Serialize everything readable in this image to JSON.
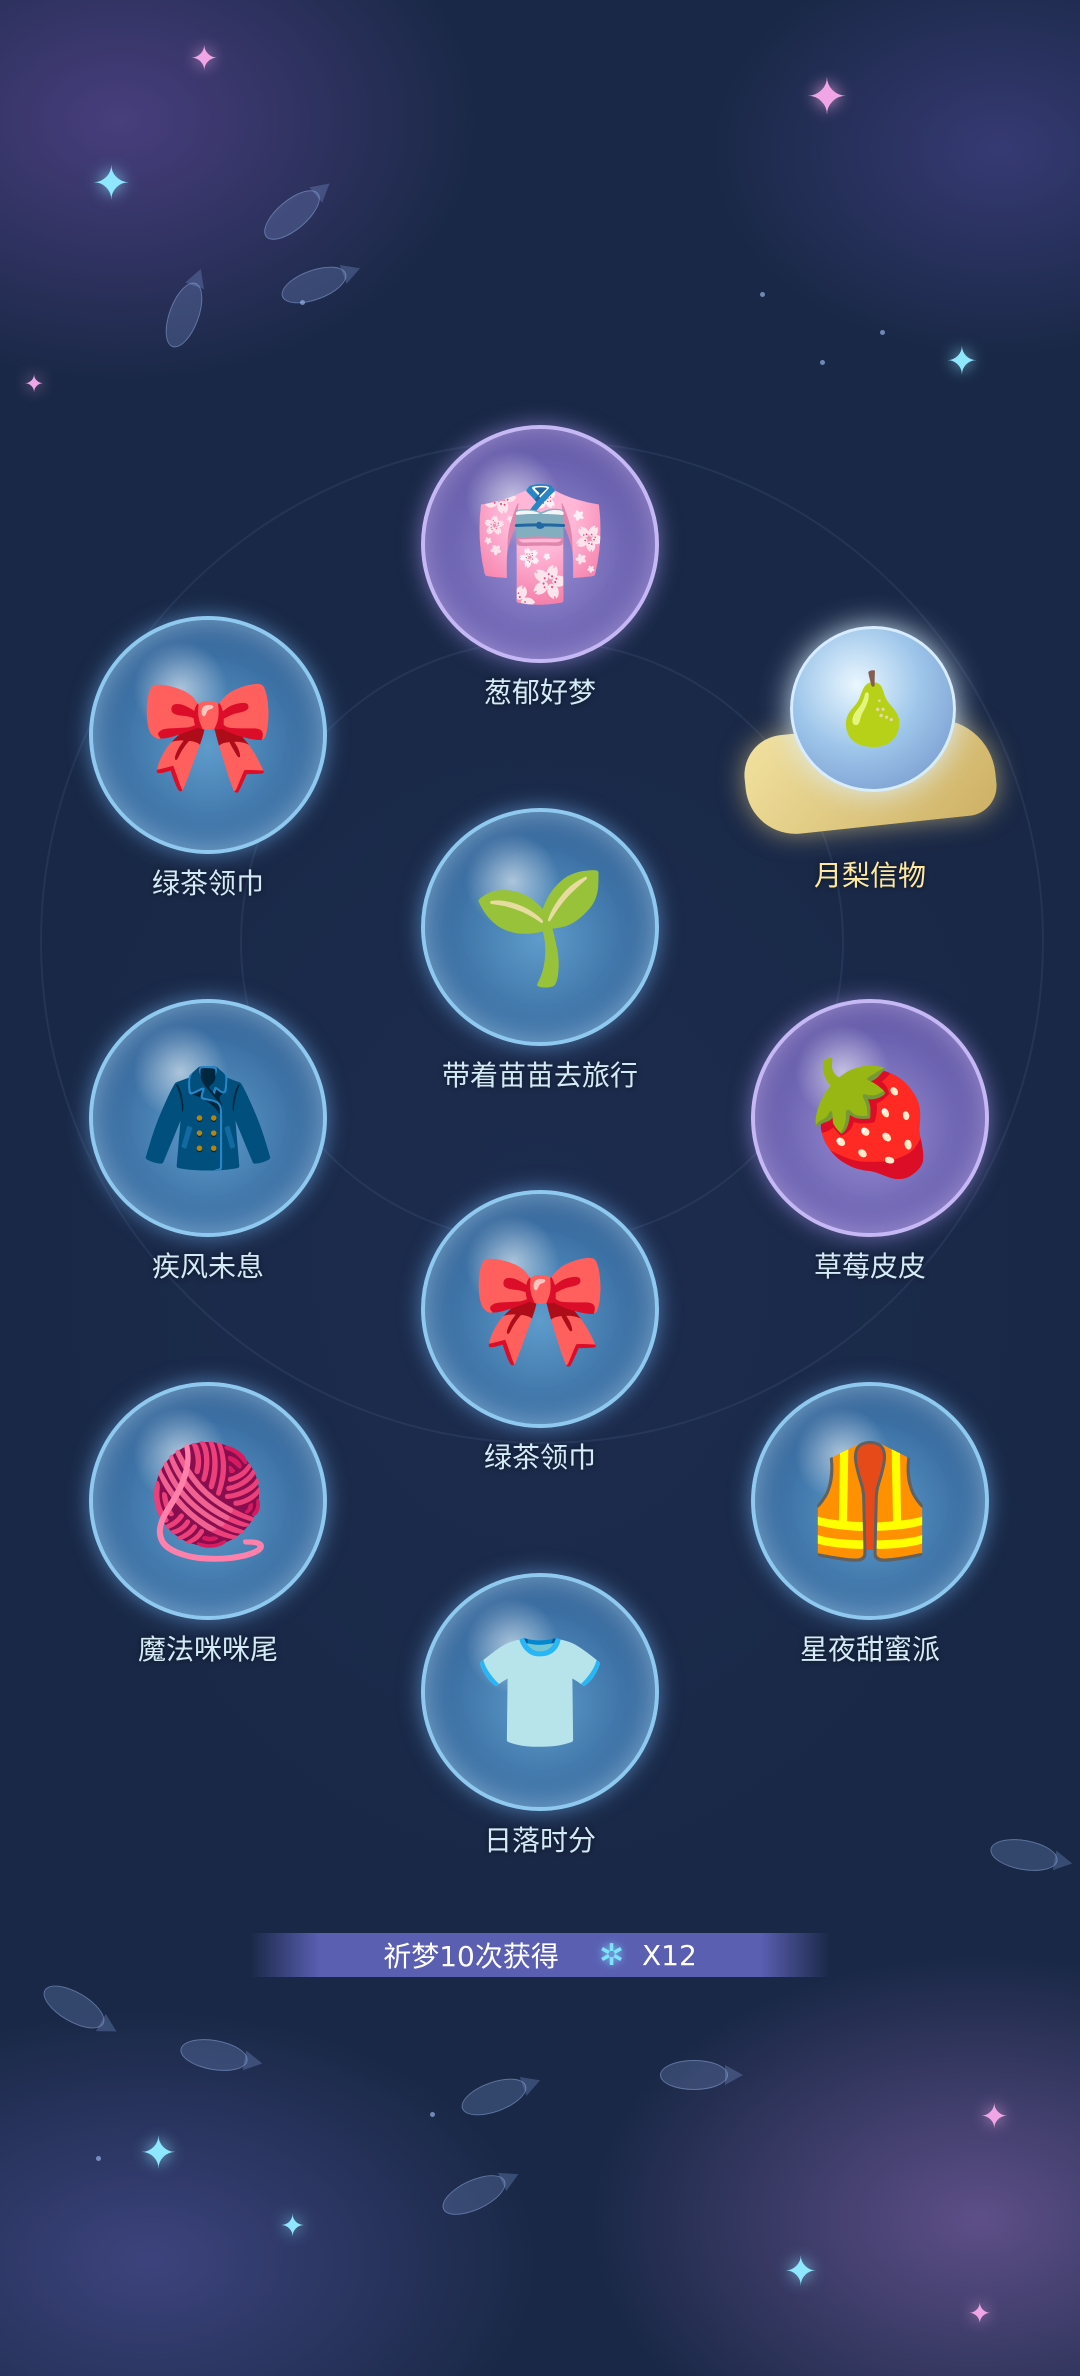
{
  "items": [
    {
      "name": "葱郁好梦",
      "icon": "green-pajamas-icon",
      "glyph": "👘"
    },
    {
      "name": "绿茶领巾",
      "icon": "yellow-scarf-icon",
      "glyph": "🎀"
    },
    {
      "name": "月梨信物",
      "icon": "moon-pear-token-icon",
      "glyph": "🍐"
    },
    {
      "name": "带着苗苗去旅行",
      "icon": "sprout-outfit-icon",
      "glyph": "🌱"
    },
    {
      "name": "疾风未息",
      "icon": "black-cloak-icon",
      "glyph": "🧥"
    },
    {
      "name": "草莓皮皮",
      "icon": "strawberry-outfit-icon",
      "glyph": "🍓"
    },
    {
      "name": "绿茶领巾",
      "icon": "yellow-scarf-icon",
      "glyph": "🎀"
    },
    {
      "name": "魔法咪咪尾",
      "icon": "yarn-tail-icon",
      "glyph": "🧶"
    },
    {
      "name": "星夜甜蜜派",
      "icon": "starry-vest-icon",
      "glyph": "🦺"
    },
    {
      "name": "日落时分",
      "icon": "sunset-shirt-icon",
      "glyph": "👕"
    }
  ],
  "banner": {
    "text": "祈梦10次获得",
    "gem_icon": "dream-crystal-icon",
    "gem_glyph": "✲",
    "count": "X12"
  }
}
